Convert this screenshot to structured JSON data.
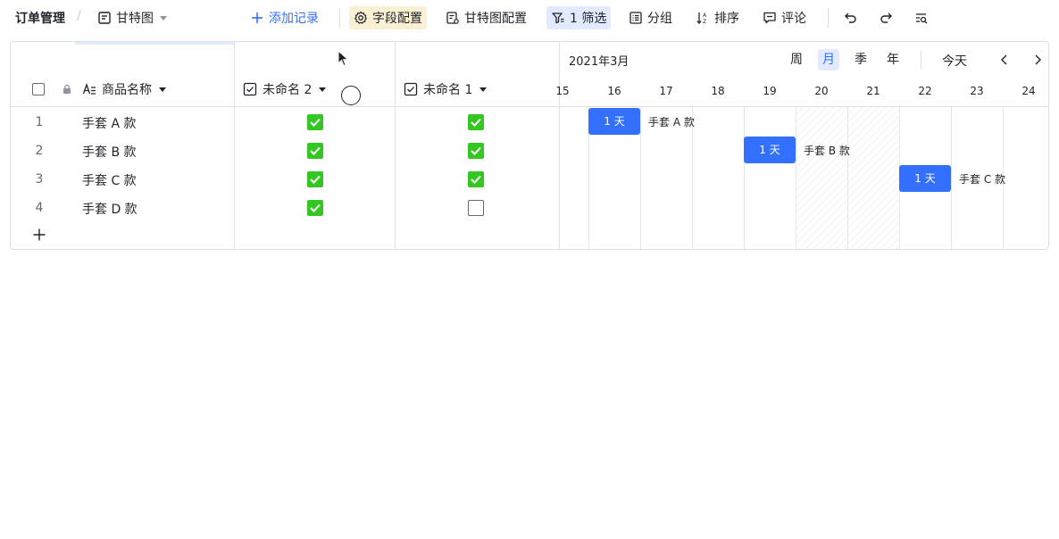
{
  "toolbar": {
    "breadcrumb": "订单管理",
    "separator": "/",
    "view_name": "甘特图",
    "add_record": "添加记录",
    "field_config": "字段配置",
    "gantt_config": "甘特图配置",
    "filter": "1 筛选",
    "group": "分组",
    "sort": "排序",
    "comment": "评论"
  },
  "grid": {
    "columns": [
      {
        "label": "商品名称"
      },
      {
        "label": "未命名 2"
      },
      {
        "label": "未命名 1"
      }
    ],
    "rows": [
      {
        "num": "1",
        "name": "手套 A 款",
        "col2": true,
        "col1": true
      },
      {
        "num": "2",
        "name": "手套 B 款",
        "col2": true,
        "col1": true
      },
      {
        "num": "3",
        "name": "手套 C 款",
        "col2": true,
        "col1": true
      },
      {
        "num": "4",
        "name": "手套 D 款",
        "col2": true,
        "col1": false
      }
    ]
  },
  "gantt": {
    "month": "2021年3月",
    "views": [
      "周",
      "月",
      "季",
      "年"
    ],
    "selected_view": "月",
    "today": "今天",
    "days": [
      "15",
      "16",
      "17",
      "18",
      "19",
      "20",
      "21",
      "22",
      "23",
      "24"
    ],
    "weekend_days": [
      "20",
      "21"
    ],
    "tasks": [
      {
        "name": "手套 A 款",
        "duration": "1 天",
        "day": "16"
      },
      {
        "name": "手套 B 款",
        "duration": "1 天",
        "day": "19"
      },
      {
        "name": "手套 C 款",
        "duration": "1 天",
        "day": "22"
      }
    ]
  },
  "colors": {
    "accent": "#3370ff",
    "checkbox_on": "#34c724",
    "active_yellow": "#faf0d4",
    "active_blue": "#e1eaff"
  }
}
